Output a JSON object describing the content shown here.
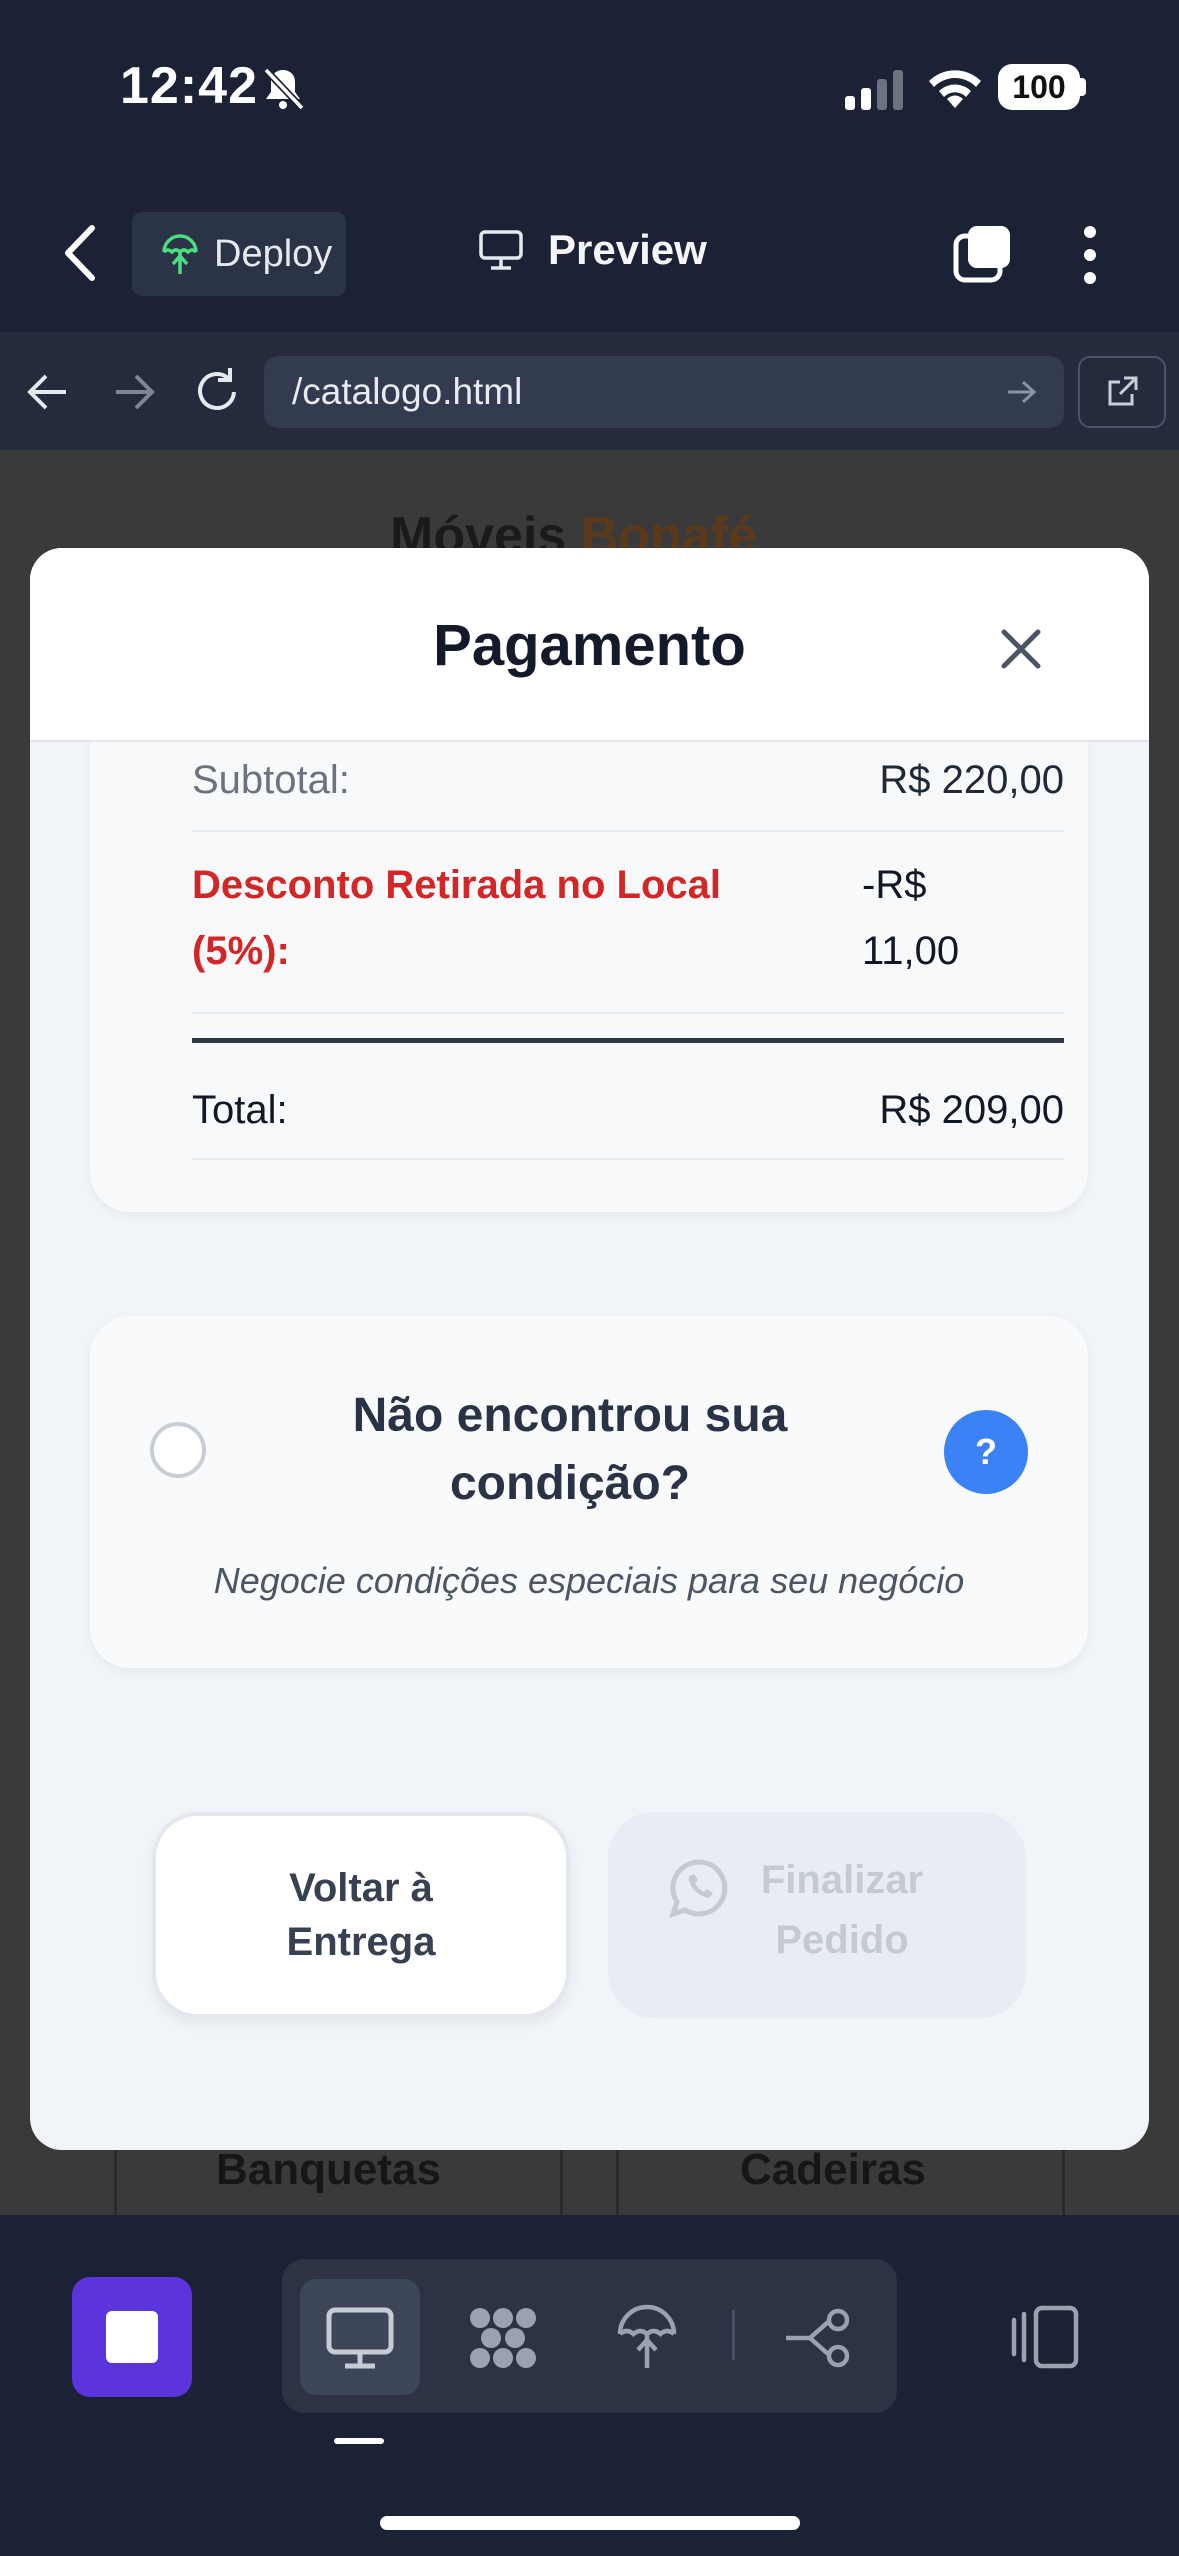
{
  "status_bar": {
    "time": "12:42",
    "battery": "100"
  },
  "top_bar": {
    "deploy_label": "Deploy",
    "preview_label": "Preview"
  },
  "url_bar": {
    "url": "/catalogo.html"
  },
  "background_page": {
    "brand_main": "Móveis ",
    "brand_accent": "Bonafé",
    "categories": [
      "Banquetas",
      "Cadeiras"
    ]
  },
  "modal": {
    "title": "Pagamento",
    "summary": {
      "subtotal_label": "Subtotal:",
      "subtotal_value": "R$ 220,00",
      "discount_label": "Desconto Retirada no Local (5%):",
      "discount_value": "-R$ 11,00",
      "total_label": "Total:",
      "total_value": "R$ 209,00"
    },
    "condition": {
      "title": "Não encontrou sua condição?",
      "subtitle": "Negocie condições especiais para seu negócio",
      "help_label": "?"
    },
    "buttons": {
      "back": "Voltar à Entrega",
      "finish": "Finalizar Pedido"
    }
  },
  "colors": {
    "accent": "#5b34db",
    "discount": "#d32626",
    "help": "#3b82f6"
  }
}
